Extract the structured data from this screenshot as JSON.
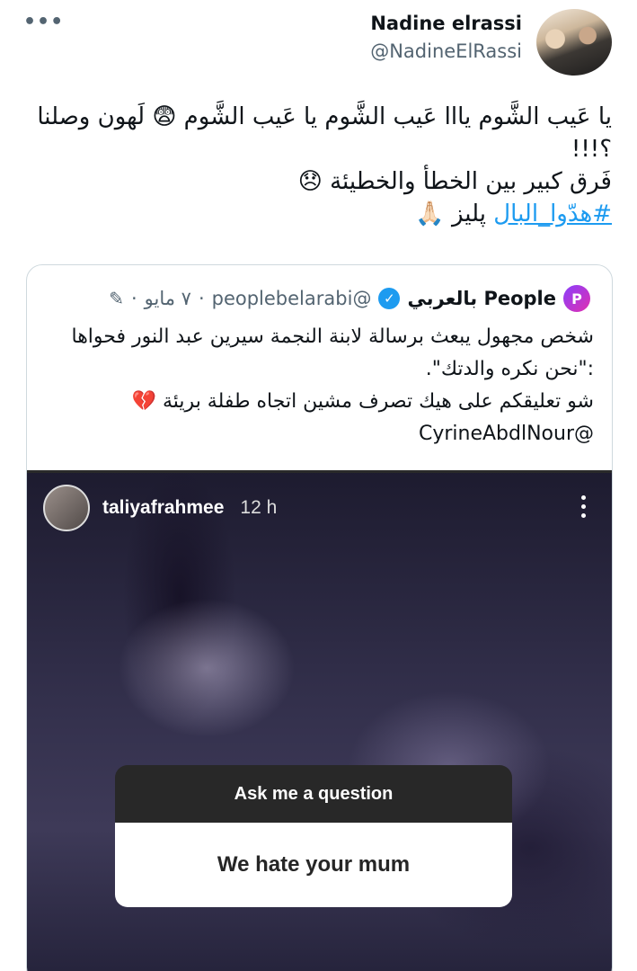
{
  "tweet": {
    "more_label": "•••",
    "author_name": "Nadine elrassi",
    "author_handle": "@NadineElRassi",
    "lines": [
      "يا عَيب الشَّوم يااا عَيب الشَّوم يا عَيب الشَّوم 😨 لَهون وصلنا",
      "؟!!!",
      "فَرق كبير بين الخطأ والخطيئة 😞"
    ],
    "hashtag": "#هدّوا_البال",
    "hashtag_suffix": " پليز 🙏🏻"
  },
  "quote": {
    "avatar_letter": "P",
    "name": "People بالعربي",
    "verified_glyph": "✓",
    "handle": "@peoplebelarabi",
    "separator": "·",
    "date": "٧ مايو",
    "lines": [
      "شخص مجهول يبعث برسالة لابنة النجمة سيرين عبد النور فحواها",
      ":\"نحن نكره والدتك\".",
      "شو تعليقكم على هيك تصرف مشين اتجاه طفلة بريئة 💔",
      "@CyrineAbdlNour"
    ]
  },
  "story": {
    "username": "taliyafrahmee",
    "time": "12 h",
    "question_title": "Ask me a question",
    "question_answer": "We hate your mum"
  },
  "icons": {
    "more": "more-horizontal-icon",
    "verified": "verified-badge-icon",
    "edit": "pencil-icon",
    "story_menu": "more-vertical-icon"
  },
  "colors": {
    "link": "#1d9bf0",
    "text": "#0f1419",
    "muted": "#536471",
    "border": "#cfd9de"
  }
}
